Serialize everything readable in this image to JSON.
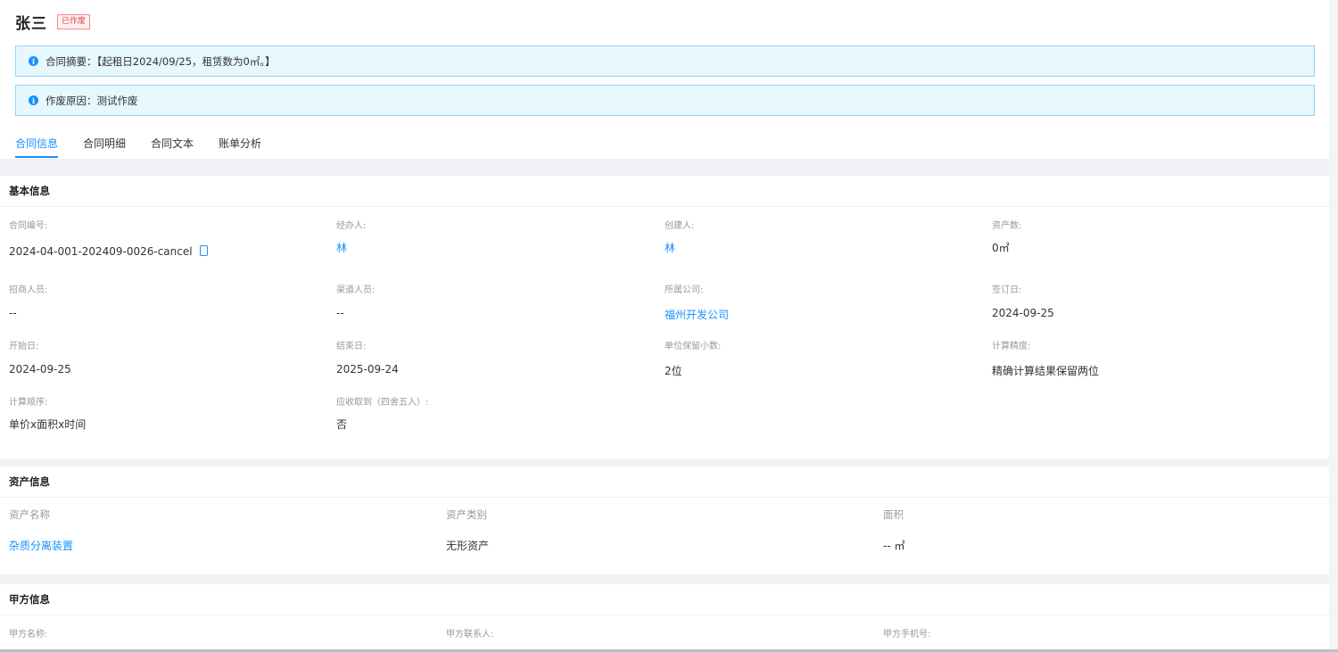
{
  "header": {
    "title": "张三",
    "badge": "已作废"
  },
  "alerts": {
    "summary": "合同摘要：【起租日2024/09/25，租赁数为0㎡。】",
    "void_reason": "作废原因：测试作废"
  },
  "tabs": [
    "合同信息",
    "合同明细",
    "合同文本",
    "账单分析"
  ],
  "basic": {
    "title": "基本信息",
    "fields": [
      {
        "label": "合同编号:",
        "value": "2024-04-001-202409-0026-cancel"
      },
      {
        "label": "经办人:",
        "value": "林"
      },
      {
        "label": "创建人:",
        "value": "林"
      },
      {
        "label": "资产数:",
        "value": "0㎡"
      },
      {
        "label": "招商人员:",
        "value": "--"
      },
      {
        "label": "渠道人员:",
        "value": "--"
      },
      {
        "label": "所属公司:",
        "value": "福州开发公司"
      },
      {
        "label": "签订日:",
        "value": "2024-09-25"
      },
      {
        "label": "开始日:",
        "value": "2024-09-25"
      },
      {
        "label": "结束日:",
        "value": "2025-09-24"
      },
      {
        "label": "单位保留小数:",
        "value": "2位"
      },
      {
        "label": "计算精度:",
        "value": "精确计算结果保留两位"
      },
      {
        "label": "计算顺序:",
        "value": "单价x面积x时间"
      },
      {
        "label": "应收取到（四舍五入）:",
        "value": "否"
      }
    ]
  },
  "asset": {
    "title": "资产信息",
    "headers": [
      "资产名称",
      "资产类别",
      "面积"
    ],
    "row": [
      "杂质分离装置",
      "无形资产",
      "-- ㎡"
    ]
  },
  "party": {
    "title": "甲方信息",
    "labels": [
      "甲方名称:",
      "甲方联系人:",
      "甲方手机号:"
    ]
  },
  "colors": {
    "accent": "#1890ff",
    "danger": "#e0454c",
    "alert_bg": "#e6f7fe"
  }
}
